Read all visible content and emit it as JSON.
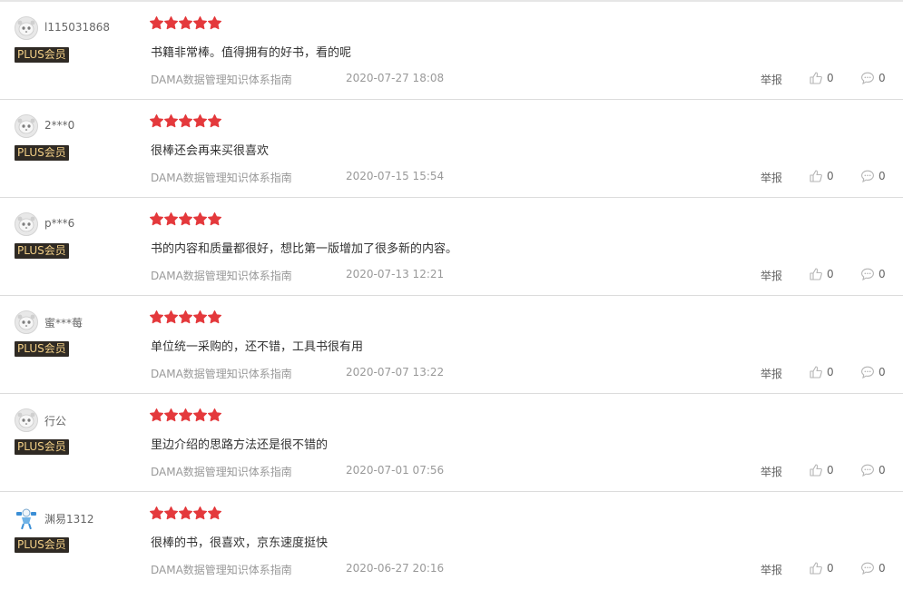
{
  "colors": {
    "star": "#e4393c",
    "plus_badge_bg": "#2f2a24",
    "plus_badge_text": "#f2cf86",
    "divider": "#dcdcdc"
  },
  "reviews": [
    {
      "username": "l115031868",
      "badge": "PLUS会员",
      "rating": 5,
      "content": "书籍非常棒。值得拥有的好书，看的呢",
      "product": "DAMA数据管理知识体系指南",
      "time": "2020-07-27 18:08",
      "report_label": "举报",
      "likes": "0",
      "comments": "0",
      "avatar_icon": "default-avatar-icon"
    },
    {
      "username": "2***0",
      "badge": "PLUS会员",
      "rating": 5,
      "content": "很棒还会再来买很喜欢",
      "product": "DAMA数据管理知识体系指南",
      "time": "2020-07-15 15:54",
      "report_label": "举报",
      "likes": "0",
      "comments": "0",
      "avatar_icon": "default-avatar-icon"
    },
    {
      "username": "p***6",
      "badge": "PLUS会员",
      "rating": 5,
      "content": "书的内容和质量都很好，想比第一版增加了很多新的内容。",
      "product": "DAMA数据管理知识体系指南",
      "time": "2020-07-13 12:21",
      "report_label": "举报",
      "likes": "0",
      "comments": "0",
      "avatar_icon": "default-avatar-icon"
    },
    {
      "username": "蜜***莓",
      "badge": "PLUS会员",
      "rating": 5,
      "content": "单位统一采购的，还不错，工具书很有用",
      "product": "DAMA数据管理知识体系指南",
      "time": "2020-07-07 13:22",
      "report_label": "举报",
      "likes": "0",
      "comments": "0",
      "avatar_icon": "default-avatar-icon"
    },
    {
      "username": "行公",
      "badge": "PLUS会员",
      "rating": 5,
      "content": "里边介绍的思路方法还是很不错的",
      "product": "DAMA数据管理知识体系指南",
      "time": "2020-07-01 07:56",
      "report_label": "举报",
      "likes": "0",
      "comments": "0",
      "avatar_icon": "default-avatar-icon"
    },
    {
      "username": "渊易1312",
      "badge": "PLUS会员",
      "rating": 5,
      "content": "很棒的书，很喜欢，京东速度挺快",
      "product": "DAMA数据管理知识体系指南",
      "time": "2020-06-27 20:16",
      "report_label": "举报",
      "likes": "0",
      "comments": "0",
      "avatar_icon": "figure-avatar-icon"
    }
  ]
}
